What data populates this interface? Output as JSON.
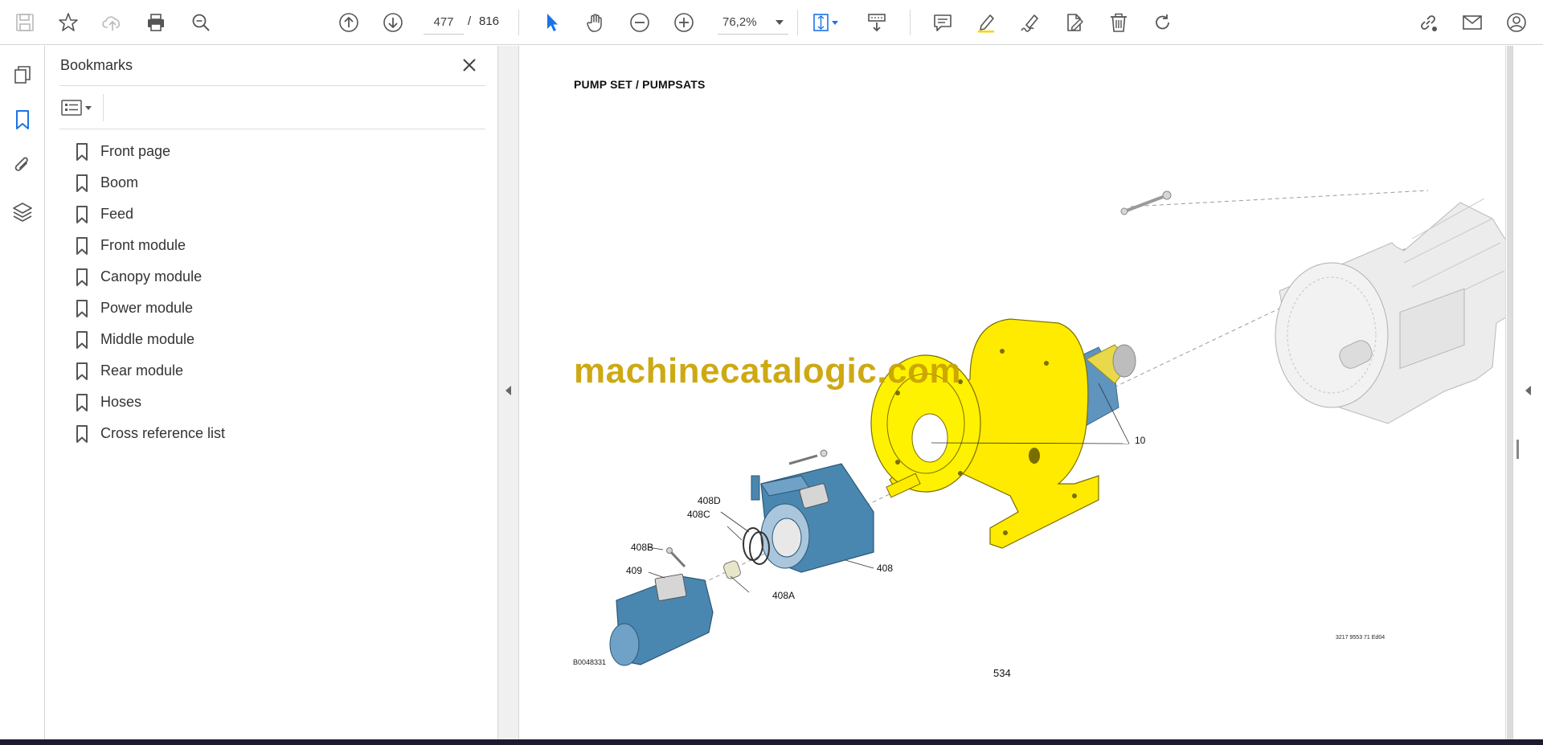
{
  "toolbar": {
    "icons": [
      "save-icon",
      "star-icon",
      "cloud-upload-icon",
      "print-icon",
      "search-zoom-icon",
      "previous-page-icon",
      "next-page-icon",
      "select-cursor-icon",
      "hand-tool-icon",
      "zoom-out-icon",
      "zoom-in-icon",
      "fit-page-icon",
      "scrolling-mode-icon",
      "comment-icon",
      "highlight-icon",
      "sign-icon",
      "edit-pdf-icon",
      "delete-icon",
      "rotate-icon",
      "share-link-icon",
      "email-icon",
      "account-icon"
    ],
    "page_current": "477",
    "page_separator": "/",
    "page_total": "816",
    "zoom": "76,2%",
    "active_tool_color": "#1a73e8"
  },
  "left_rail": {
    "icons": [
      "page-thumbnails-icon",
      "bookmarks-icon",
      "attachments-icon",
      "layers-icon"
    ],
    "active": "bookmarks-icon"
  },
  "bookmarks": {
    "title": "Bookmarks",
    "items": [
      {
        "label": "Front page"
      },
      {
        "label": "Boom"
      },
      {
        "label": "Feed"
      },
      {
        "label": "Front module"
      },
      {
        "label": "Canopy module"
      },
      {
        "label": "Power module"
      },
      {
        "label": "Middle module"
      },
      {
        "label": "Rear module"
      },
      {
        "label": "Hoses"
      },
      {
        "label": "Cross reference list"
      }
    ]
  },
  "document": {
    "heading": "PUMP SET / PUMPSATS",
    "watermark": "machinecatalogic.com",
    "callouts": {
      "c10": "10",
      "c408": "408",
      "c408A": "408A",
      "c408B": "408B",
      "c408C": "408C",
      "c408D": "408D",
      "c409": "409"
    },
    "drawing_code": "B0048331",
    "doc_reference": "3217 9553 71 Ed04",
    "page_number": "534",
    "colors": {
      "bracket": "#ffe600",
      "pump": "#4a87b0",
      "motor": "#e8e8e8"
    }
  }
}
